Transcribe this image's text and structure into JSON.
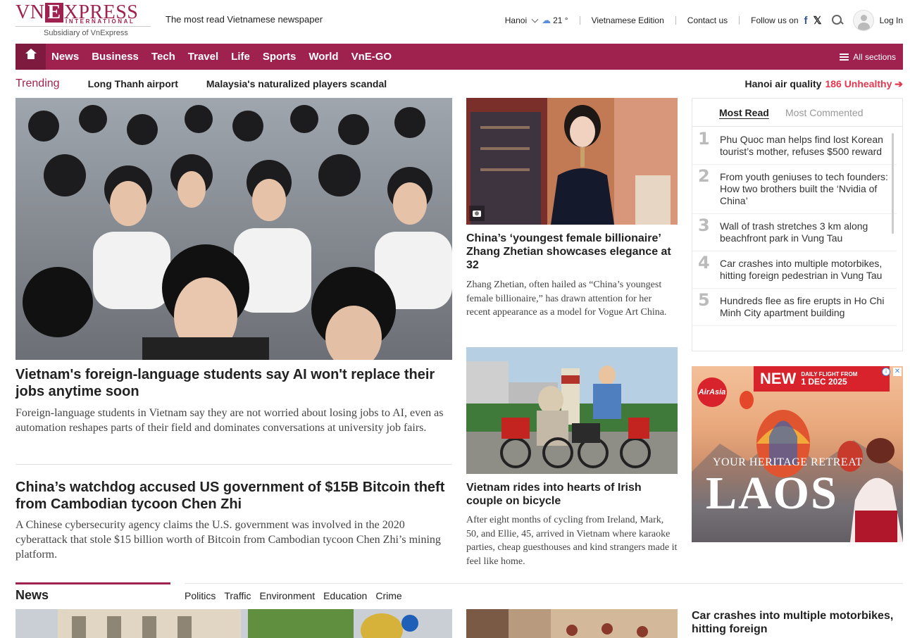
{
  "header": {
    "logo_left": "VN",
    "logo_e": "E",
    "logo_right": "XPRESS",
    "logo_intl": "INTERNATIONAL",
    "logo_sub": "Subsidiary of VnExpress",
    "tagline": "The most read Vietnamese newspaper",
    "city": "Hanoi",
    "temperature": "21 °",
    "edition": "Vietnamese Edition",
    "contact": "Contact us",
    "follow": "Follow us on",
    "login": "Log In"
  },
  "nav": {
    "items": [
      "News",
      "Business",
      "Tech",
      "Travel",
      "Life",
      "Sports",
      "World",
      "VnE-GO"
    ],
    "all_sections": "All sections"
  },
  "trending": {
    "label": "Trending",
    "items": [
      "Long Thanh airport",
      "Malaysia's naturalized players scandal"
    ],
    "air_label": "Hanoi air quality",
    "air_value": "186 Unhealthy ➔"
  },
  "lead": {
    "title": "Vietnam's foreign-language students say AI won't replace their jobs anytime soon",
    "desc": "Foreign-language students in Vietnam say they are not worried about losing jobs to AI, even as automation reshapes parts of their field and dominates conversations at university job fairs."
  },
  "article2": {
    "title": "China’s watchdog accused US government of $15B Bitcoin theft from Cambodian tycoon Chen Zhi",
    "desc": "A Chinese cybersecurity agency claims the U.S. government was involved in the 2020 cyberattack that stole $15 billion worth of Bitcoin from Cambodian tycoon Chen Zhi’s mining platform."
  },
  "mid1": {
    "title": "China’s ‘youngest female billionaire’ Zhang Zhetian showcases elegance at 32",
    "desc": "Zhang Zhetian, often hailed as “China’s youngest female billionaire,” has drawn attention for her recent appearance as a model for Vogue Art China."
  },
  "mid2": {
    "title": "Vietnam rides into hearts of Irish couple on bicycle",
    "desc": "After eight months of cycling from Ireland, Mark, 50, and Ellie, 45, arrived in Vietnam where karaoke parties, cheap guesthouses and kind strangers made it feel like home."
  },
  "most_read": {
    "tab_read": "Most Read",
    "tab_commented": "Most Commented",
    "items": [
      {
        "num": "1",
        "title": "Phu Quoc man helps find lost Korean tourist’s mother, refuses $500 reward"
      },
      {
        "num": "2",
        "title": "From youth geniuses to tech founders: How two brothers built the ‘Nvidia of China’"
      },
      {
        "num": "3",
        "title": "Wall of trash stretches 3 km along beachfront park in Vung Tau"
      },
      {
        "num": "4",
        "title": "Car crashes into multiple motorbikes, hitting foreign pedestrian in Vung Tau"
      },
      {
        "num": "5",
        "title": "Hundreds flee as fire erupts in Ho Chi Minh City apartment building"
      }
    ]
  },
  "ad": {
    "airline": "AirAsia",
    "new": "NEW",
    "flight_line": "DAILY FLIGHT FROM",
    "flight_date": "1 DEC 2025",
    "retreat": "YOUR HERITAGE RETREAT",
    "destination": "LAOS"
  },
  "news_section": {
    "label": "News",
    "subnav": [
      "Politics",
      "Traffic",
      "Environment",
      "Education",
      "Crime"
    ],
    "article_title": "Car crashes into multiple motorbikes, hitting foreign"
  },
  "colors": {
    "brand": "#9f224e",
    "alert": "#e5364f"
  }
}
